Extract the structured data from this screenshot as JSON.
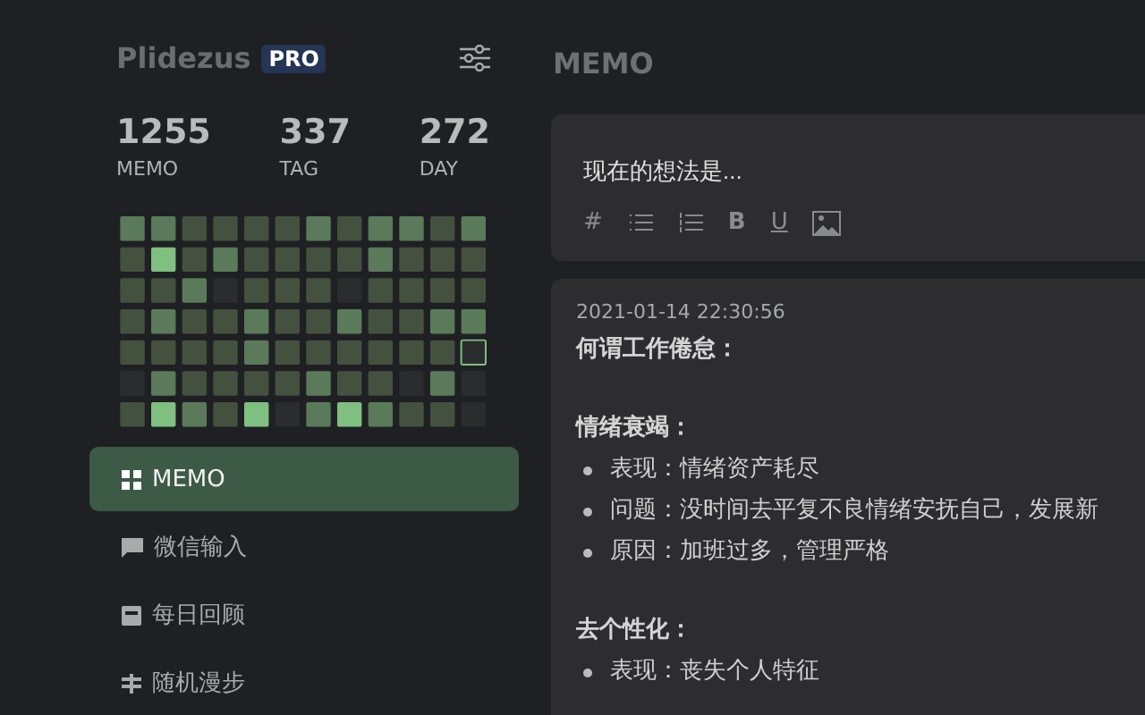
{
  "sidebar": {
    "brand": "Plidezus",
    "badge": "PRO",
    "stats": [
      {
        "value": "1255",
        "label": "MEMO"
      },
      {
        "value": "337",
        "label": "TAG"
      },
      {
        "value": "272",
        "label": "DAY"
      }
    ],
    "nav": [
      {
        "label": "MEMO",
        "selected": true
      },
      {
        "label": "微信输入",
        "selected": false
      },
      {
        "label": "每日回顾",
        "selected": false
      },
      {
        "label": "随机漫步",
        "selected": false
      }
    ]
  },
  "main": {
    "title": "MEMO",
    "editor": {
      "placeholder": "现在的想法是...",
      "tools": [
        {
          "kind": "text",
          "text": "#"
        },
        {
          "kind": "list"
        },
        {
          "kind": "ordered"
        },
        {
          "kind": "bold",
          "text": "B"
        },
        {
          "kind": "underline",
          "text": "U"
        },
        {
          "kind": "image"
        }
      ]
    },
    "memo": {
      "time": "2021-01-14 22:30:56",
      "blocks": [
        {
          "kind": "heading",
          "text": "何谓工作倦怠："
        },
        {
          "kind": "gap"
        },
        {
          "kind": "heading",
          "text": "情绪衰竭："
        },
        {
          "kind": "bullet",
          "text": "表现：情绪资产耗尽"
        },
        {
          "kind": "bullet",
          "text": "问题：没时间去平复不良情绪安抚自己，发展新"
        },
        {
          "kind": "bullet",
          "text": "原因：加班过多，管理严格"
        },
        {
          "kind": "gap"
        },
        {
          "kind": "heading",
          "text": "去个性化："
        },
        {
          "kind": "bullet",
          "text": "表现：丧失个人特征"
        }
      ]
    }
  }
}
